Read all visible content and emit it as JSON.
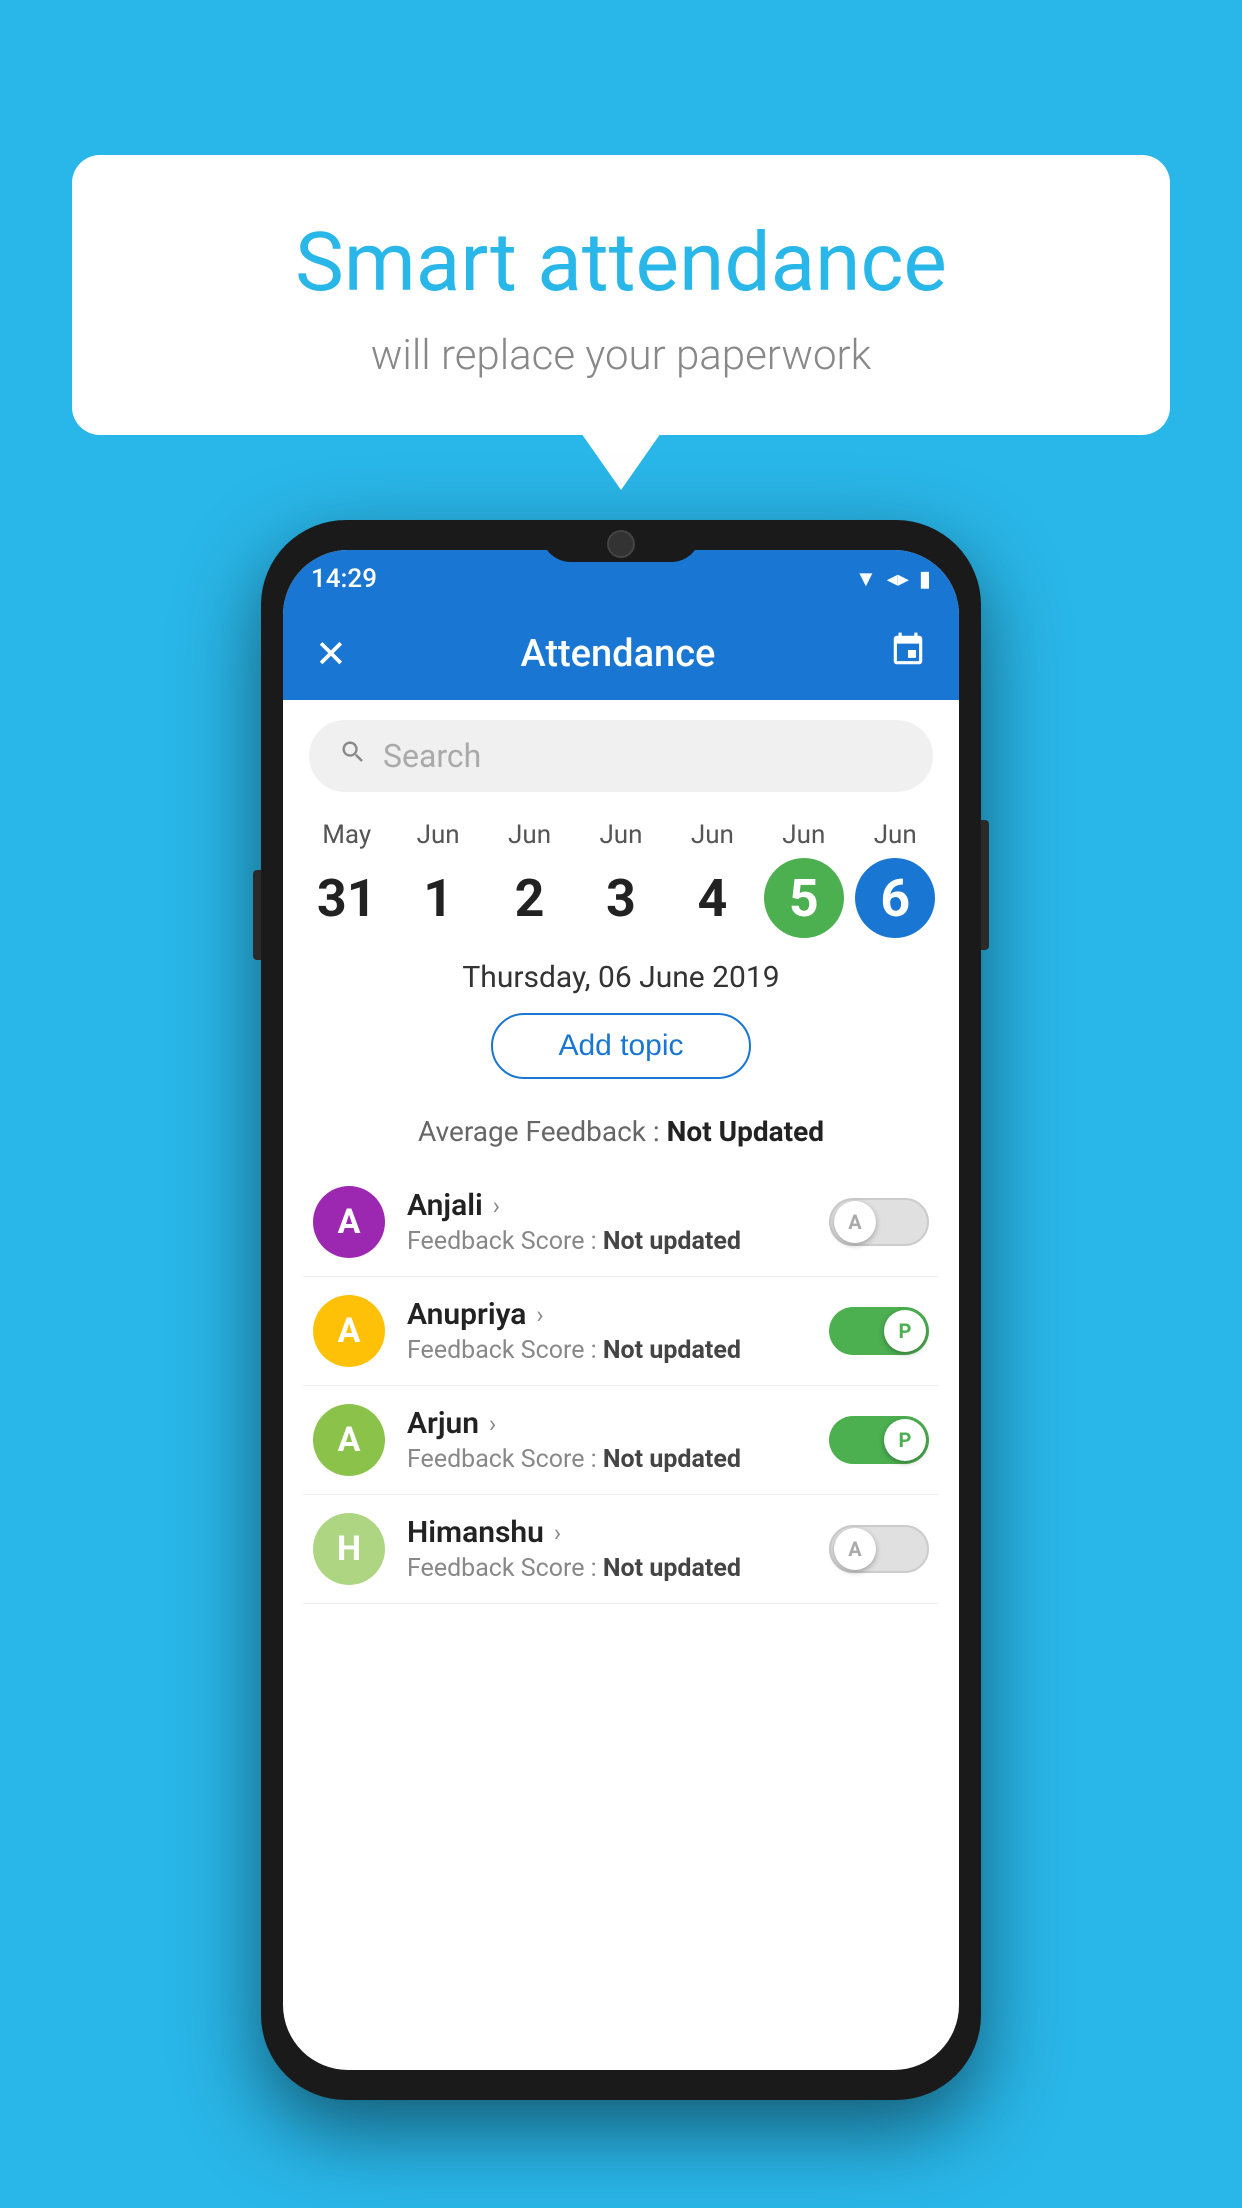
{
  "background_color": "#29b6e8",
  "bubble": {
    "title": "Smart attendance",
    "subtitle": "will replace your paperwork"
  },
  "phone": {
    "status_bar": {
      "time": "14:29",
      "wifi_icon": "▼",
      "signal_icon": "▲",
      "battery_icon": "▮"
    },
    "app_bar": {
      "close_label": "✕",
      "title": "Attendance",
      "calendar_icon": "📅"
    },
    "search": {
      "placeholder": "Search",
      "icon": "🔍"
    },
    "calendar": {
      "days": [
        {
          "month": "May",
          "date": "31",
          "state": "normal"
        },
        {
          "month": "Jun",
          "date": "1",
          "state": "normal"
        },
        {
          "month": "Jun",
          "date": "2",
          "state": "normal"
        },
        {
          "month": "Jun",
          "date": "3",
          "state": "normal"
        },
        {
          "month": "Jun",
          "date": "4",
          "state": "normal"
        },
        {
          "month": "Jun",
          "date": "5",
          "state": "today"
        },
        {
          "month": "Jun",
          "date": "6",
          "state": "selected"
        }
      ]
    },
    "selected_date": "Thursday, 06 June 2019",
    "add_topic_label": "Add topic",
    "avg_feedback_label": "Average Feedback :",
    "avg_feedback_value": "Not Updated",
    "students": [
      {
        "name": "Anjali",
        "avatar_letter": "A",
        "avatar_color": "#9c27b0",
        "feedback_label": "Feedback Score :",
        "feedback_value": "Not updated",
        "toggle_state": "off",
        "toggle_letter": "A"
      },
      {
        "name": "Anupriya",
        "avatar_letter": "A",
        "avatar_color": "#ffc107",
        "feedback_label": "Feedback Score :",
        "feedback_value": "Not updated",
        "toggle_state": "on",
        "toggle_letter": "P"
      },
      {
        "name": "Arjun",
        "avatar_letter": "A",
        "avatar_color": "#8bc34a",
        "feedback_label": "Feedback Score :",
        "feedback_value": "Not updated",
        "toggle_state": "on",
        "toggle_letter": "P"
      },
      {
        "name": "Himanshu",
        "avatar_letter": "H",
        "avatar_color": "#aed581",
        "feedback_label": "Feedback Score :",
        "feedback_value": "Not updated",
        "toggle_state": "off",
        "toggle_letter": "A"
      }
    ]
  }
}
